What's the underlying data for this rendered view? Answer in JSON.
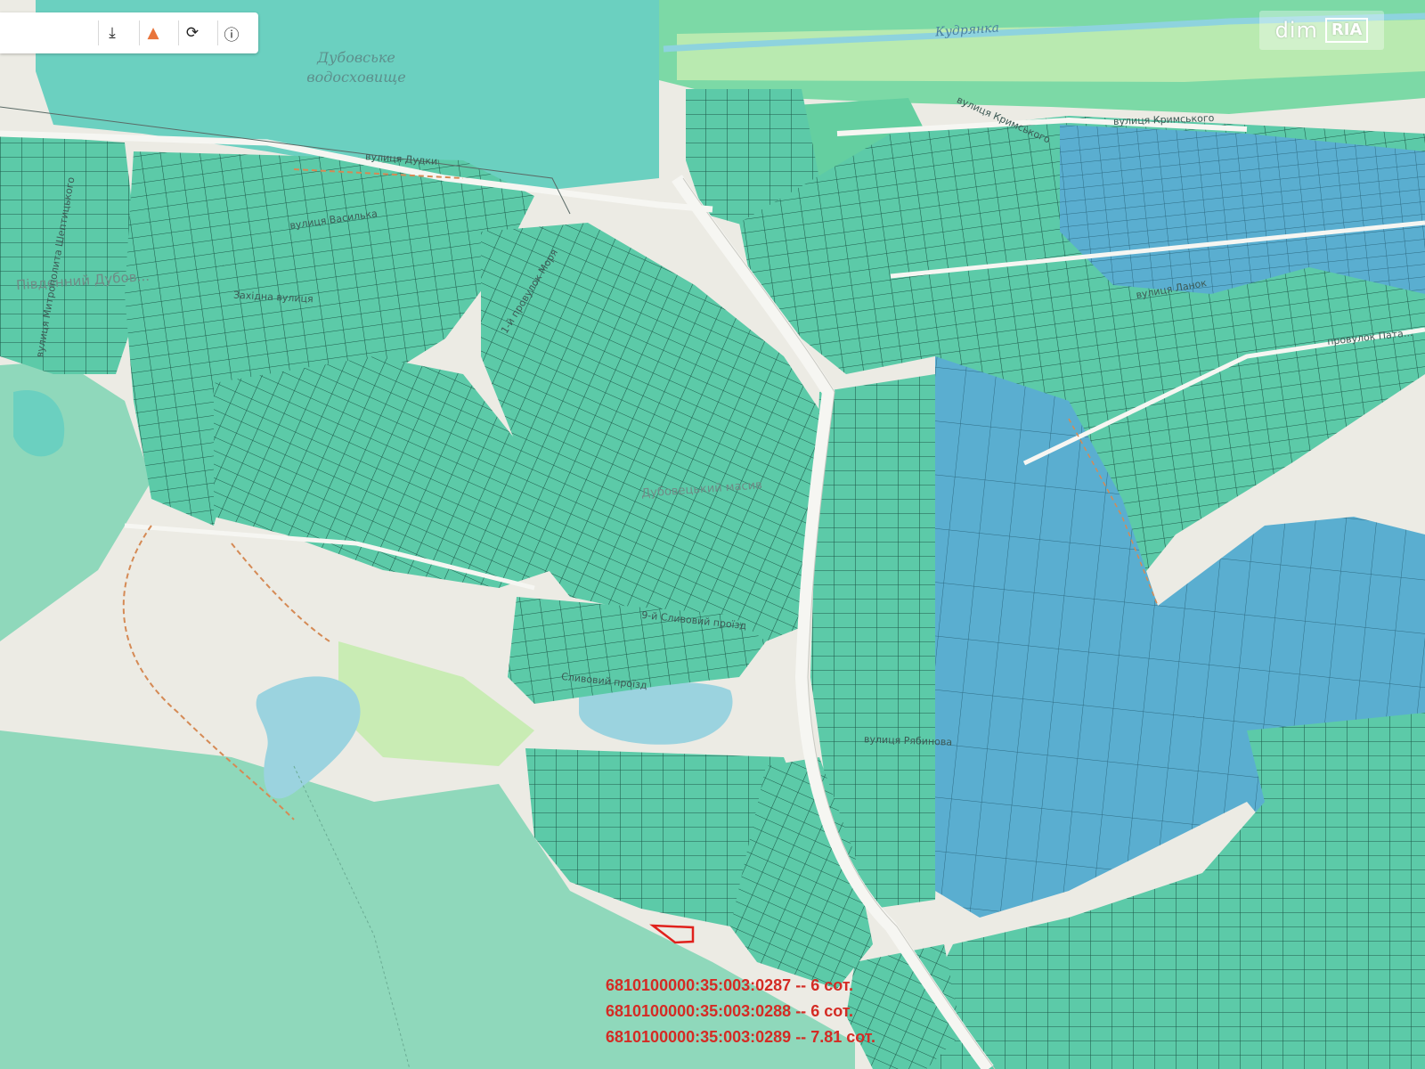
{
  "toolbar": {
    "buttons": [
      {
        "name": "download-icon",
        "glyph": "⤓"
      },
      {
        "name": "warning-icon",
        "glyph": "▲"
      },
      {
        "name": "refresh-icon",
        "glyph": "⟳"
      },
      {
        "name": "info-icon",
        "glyph": "ⓘ"
      }
    ]
  },
  "brand": {
    "part1": "dim",
    "part2": "RIA"
  },
  "water": {
    "reservoir_line1": "Дубовське",
    "reservoir_line2": "водосховище",
    "river": "Кудрянка"
  },
  "districts": {
    "south": "Південний Дубов...",
    "center": "Дубовецький масив"
  },
  "streets": [
    "вулиця Кримського",
    "вулиця Кримського",
    "вулиця Дудки",
    "вулиця Василька",
    "Західна вулиця",
    "вулиця Митрополита Шептицького",
    "1-й провулок Моря",
    "вулиця Ланок",
    "провулок Пата...",
    "9-й Сливовий проїзд",
    "Сливовий проїзд",
    "вулиця Рябинова"
  ],
  "colors": {
    "parcel": "#5ccaa8",
    "parcel_blue": "#5aaed0",
    "reservoir": "#6bd0c0",
    "forest": "#8fd8bb",
    "highlight": "#e0211c",
    "text_red": "#d42b24"
  },
  "parcels": [
    {
      "id": "6810100000:35:003:0287",
      "area": "6 сот."
    },
    {
      "id": "6810100000:35:003:0288",
      "area": "6 сот."
    },
    {
      "id": "6810100000:35:003:0289",
      "area": "7.81 сот."
    }
  ]
}
